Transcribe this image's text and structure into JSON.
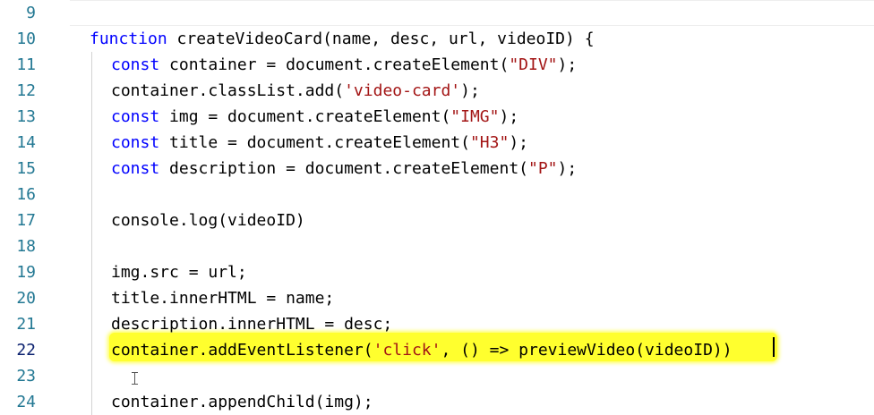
{
  "editor": {
    "line_numbers": [
      "9",
      "10",
      "11",
      "12",
      "13",
      "14",
      "15",
      "16",
      "17",
      "18",
      "19",
      "20",
      "21",
      "22",
      "23",
      "24"
    ],
    "active_line": "22",
    "lines": {
      "l10": {
        "kw": "function",
        "rest": " createVideoCard(name, desc, url, videoID) {"
      },
      "l11": {
        "kw": "const",
        "mid": " container = document.createElement(",
        "str": "\"DIV\"",
        "end": ");"
      },
      "l12": {
        "pre": "container.classList.add(",
        "str": "'video-card'",
        "end": ");"
      },
      "l13": {
        "kw": "const",
        "mid": " img = document.createElement(",
        "str": "\"IMG\"",
        "end": ");"
      },
      "l14": {
        "kw": "const",
        "mid": " title = document.createElement(",
        "str": "\"H3\"",
        "end": ");"
      },
      "l15": {
        "kw": "const",
        "mid": " description = document.createElement(",
        "str": "\"P\"",
        "end": ");"
      },
      "l17": {
        "text": "console.log(videoID)"
      },
      "l19": {
        "text": "img.src = url;"
      },
      "l20": {
        "text": "title.innerHTML = name;"
      },
      "l21": {
        "text": "description.innerHTML = desc;"
      },
      "l22": {
        "pre": "container.addEventListener(",
        "str": "'click'",
        "end": ", () => previewVideo(videoID))"
      },
      "l24": {
        "text": "container.appendChild(img);"
      }
    },
    "colors": {
      "keyword": "#0000ff",
      "string": "#a31515",
      "line_number": "#237893",
      "active_line_number": "#0b216f",
      "highlighter": "#ffff2e"
    }
  }
}
